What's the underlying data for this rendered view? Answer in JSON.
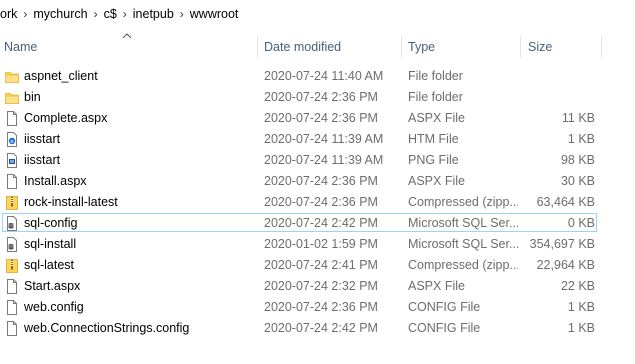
{
  "breadcrumb": [
    "ork",
    "mychurch",
    "c$",
    "inetpub",
    "wwwroot"
  ],
  "columns": {
    "name": "Name",
    "date": "Date modified",
    "type": "Type",
    "size": "Size"
  },
  "files": [
    {
      "name": "aspnet_client",
      "date": "2020-07-24 11:40 AM",
      "type": "File folder",
      "size": "",
      "icon": "folder-icon"
    },
    {
      "name": "bin",
      "date": "2020-07-24 2:36 PM",
      "type": "File folder",
      "size": "",
      "icon": "folder-icon"
    },
    {
      "name": "Complete.aspx",
      "date": "2020-07-24 2:36 PM",
      "type": "ASPX File",
      "size": "11 KB",
      "icon": "document-icon"
    },
    {
      "name": "iisstart",
      "date": "2020-07-24 11:39 AM",
      "type": "HTM File",
      "size": "1 KB",
      "icon": "html-file-icon"
    },
    {
      "name": "iisstart",
      "date": "2020-07-24 11:39 AM",
      "type": "PNG File",
      "size": "98 KB",
      "icon": "image-file-icon"
    },
    {
      "name": "Install.aspx",
      "date": "2020-07-24 2:36 PM",
      "type": "ASPX File",
      "size": "30 KB",
      "icon": "document-icon"
    },
    {
      "name": "rock-install-latest",
      "date": "2020-07-24 2:36 PM",
      "type": "Compressed (zipp...",
      "size": "63,464 KB",
      "icon": "zip-folder-icon"
    },
    {
      "name": "sql-config",
      "date": "2020-07-24 2:42 PM",
      "type": "Microsoft SQL Ser...",
      "size": "0 KB",
      "icon": "sql-file-icon",
      "selected": true
    },
    {
      "name": "sql-install",
      "date": "2020-01-02 1:59 PM",
      "type": "Microsoft SQL Ser...",
      "size": "354,697 KB",
      "icon": "sql-file-icon"
    },
    {
      "name": "sql-latest",
      "date": "2020-07-24 2:41 PM",
      "type": "Compressed (zipp...",
      "size": "22,964 KB",
      "icon": "zip-folder-icon"
    },
    {
      "name": "Start.aspx",
      "date": "2020-07-24 2:32 PM",
      "type": "ASPX File",
      "size": "22 KB",
      "icon": "document-icon"
    },
    {
      "name": "web.config",
      "date": "2020-07-24 2:36 PM",
      "type": "CONFIG File",
      "size": "1 KB",
      "icon": "document-icon"
    },
    {
      "name": "web.ConnectionStrings.config",
      "date": "2020-07-24 2:42 PM",
      "type": "CONFIG File",
      "size": "1 KB",
      "icon": "document-icon"
    }
  ],
  "colors": {
    "folder": "#ffd258",
    "selection_border": "#99d1ff",
    "header_text": "#4c607a",
    "detail_text": "#6d6d6d",
    "ie_blue": "#1e6fd0",
    "zip_gold": "#d7a52e"
  }
}
